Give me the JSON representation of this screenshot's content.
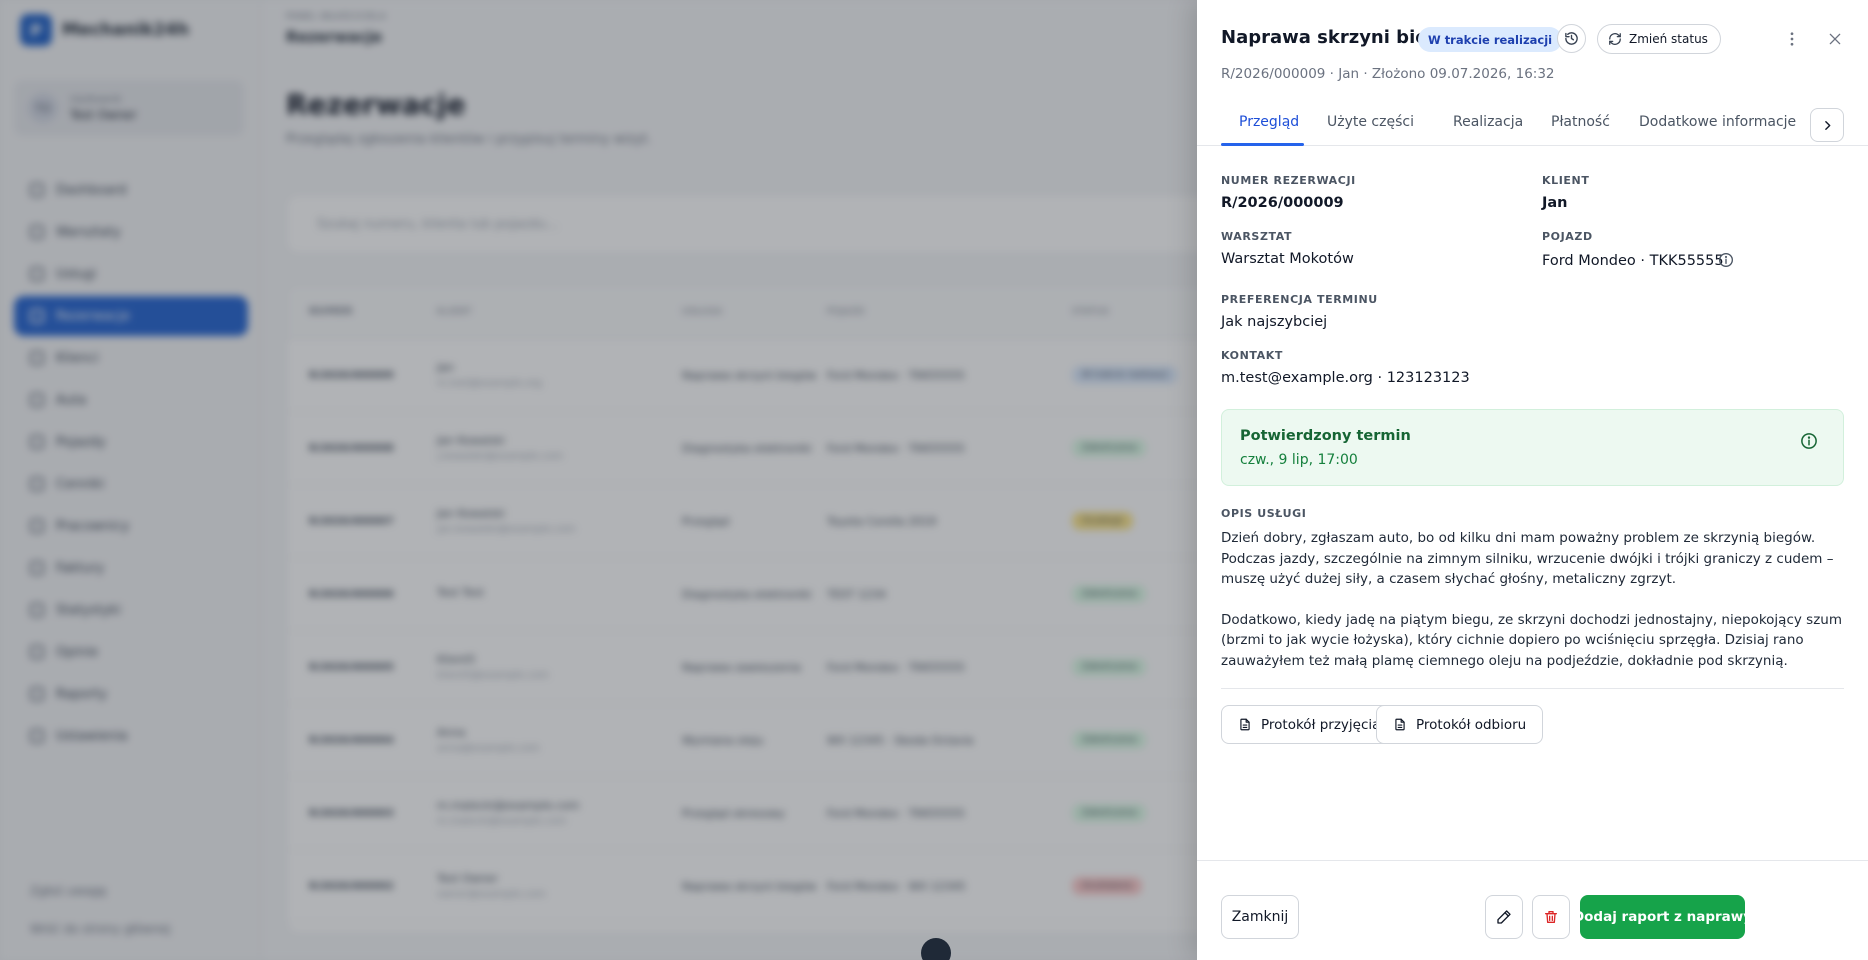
{
  "background": {
    "logo_text": "Mechanik24h",
    "user_role": "Użytkownik",
    "user_name": "Test Owner",
    "user_initials": "TO",
    "nav": [
      "Dashboard",
      "Warsztaty",
      "Usługi",
      "Rezerwacje",
      "Klienci",
      "Auta",
      "Pojazdy",
      "Cenniki",
      "Pracownicy",
      "Faktury",
      "Statystyki",
      "Opinie",
      "Raporty",
      "Ustawienia"
    ],
    "footer_links": [
      "Zgłoś uwagę",
      "Wróć do strony głównej"
    ],
    "breadcrumb": "PANEL WŁAŚCICIELA",
    "breadcrumb_title": "Rezerwacje",
    "title": "Rezerwacje",
    "subtitle": "Przeglądaj zgłoszenia klientów i przypisuj terminy wizyt.",
    "search_placeholder": "Szukaj numeru, klienta lub pojazdu...",
    "table_headers": [
      "NUMER",
      "KLIENT",
      "USŁUGA",
      "POJAZD",
      "STATUS"
    ],
    "rows": [
      {
        "number": "R/2026/000009",
        "client": "Jan",
        "email": "m.test@example.org",
        "service": "Naprawa skrzyni biegów",
        "vehicle": "Ford Mondeo · TKK55555",
        "status": "W trakcie realizacji",
        "status_color": "#dbeafe"
      },
      {
        "number": "R/2026/000008",
        "client": "Jan Kowalski",
        "email": "j.kowalski@example.com",
        "service": "Diagnostyka elektroniki",
        "vehicle": "Ford Mondeo · TKK55555",
        "status": "Zakończona",
        "status_color": "#dcfce7"
      },
      {
        "number": "R/2026/000007",
        "client": "Jan Kowalski",
        "email": "jan.kowalski@example.com",
        "service": "Przegląd",
        "vehicle": "Toyota Corolla 2019",
        "status": "Oczekuje",
        "status_color": "#fde68a"
      },
      {
        "number": "R/2026/000006",
        "client": "Test Test",
        "email": "",
        "service": "Diagnostyka elektroniki",
        "vehicle": "TEST 1234",
        "status": "Zakończona",
        "status_color": "#dcfce7"
      },
      {
        "number": "R/2026/000005",
        "client": "Klient5",
        "email": "klient5@example.com",
        "service": "Naprawa zawieszenia",
        "vehicle": "Ford Mondeo · TKK55555",
        "status": "Zakończona",
        "status_color": "#dcfce7"
      },
      {
        "number": "R/2026/000004",
        "client": "Anna",
        "email": "anna@example.com",
        "service": "Wymiana oleju",
        "vehicle": "WX 12345 · Skoda Octavia",
        "status": "Zakończona",
        "status_color": "#dcfce7"
      },
      {
        "number": "R/2026/000003",
        "client": "m.malecki@example.com",
        "email": "m.malecki@example.com",
        "service": "Przegląd okresowy",
        "vehicle": "Ford Mondeo · TKK55555",
        "status": "Zakończona",
        "status_color": "#dcfce7"
      },
      {
        "number": "R/2026/000002",
        "client": "Test Owner",
        "email": "owner@example.com",
        "service": "Naprawa skrzyni biegów",
        "vehicle": "Ford Mondeo · WX 12345",
        "status": "Anulowana",
        "status_color": "#fecaca"
      }
    ]
  },
  "panel": {
    "title": "Naprawa skrzyni biegów",
    "status_badge": "W trakcie realizacji",
    "change_status_label": "Zmień status",
    "meta": "R/2026/000009 · Jan · Złożono 09.07.2026, 16:32",
    "tabs": [
      "Przegląd",
      "Użyte części",
      "Realizacja",
      "Płatność",
      "Dodatkowe informacje"
    ],
    "active_tab": "Przegląd",
    "fields": {
      "reservation_number_label": "NUMER REZERWACJI",
      "reservation_number": "R/2026/000009",
      "client_label": "KLIENT",
      "client": "Jan",
      "workshop_label": "WARSZTAT",
      "workshop": "Warsztat Mokotów",
      "vehicle_label": "POJAZD",
      "vehicle": "Ford Mondeo · TKK55555",
      "term_pref_label": "PREFERENCJA TERMINU",
      "term_pref": "Jak najszybciej",
      "contact_label": "KONTAKT",
      "contact": "m.test@example.org · 123123123"
    },
    "confirmed_term": {
      "title": "Potwierdzony termin",
      "value": "czw., 9 lip, 17:00"
    },
    "description_label": "OPIS USŁUGI",
    "description_paragraphs": [
      "Dzień dobry, zgłaszam auto, bo od kilku dni mam poważny problem ze skrzynią biegów. Podczas jazdy, szczególnie na zimnym silniku, wrzucenie dwójki i trójki graniczy z cudem – muszę użyć dużej siły, a czasem słychać głośny, metaliczny zgrzyt.",
      "Dodatkowo, kiedy jadę na piątym biegu, ze skrzyni dochodzi jednostajny, niepokojący szum (brzmi to jak wycie łożyska), który cichnie dopiero po wciśnięciu sprzęgła. Dzisiaj rano zauważyłem też małą plamę ciemnego oleju na podjeździe, dokładnie pod skrzynią."
    ],
    "documents": [
      "Protokół przyjęcia",
      "Protokół odbioru"
    ],
    "footer": {
      "close_label": "Zamknij",
      "primary_label": "Dodaj raport z naprawy"
    }
  },
  "colors": {
    "accent": "#2563eb",
    "success": "#16a34a",
    "danger": "#dc2626",
    "badge_bg": "#dbeafe"
  },
  "icons": {
    "history": "history-icon",
    "change_status": "refresh-icon",
    "more": "more-vertical-icon",
    "close": "close-icon",
    "tab_next": "chevron-right-icon",
    "info": "info-icon",
    "document": "document-icon",
    "edit": "pencil-icon",
    "delete": "trash-icon"
  }
}
